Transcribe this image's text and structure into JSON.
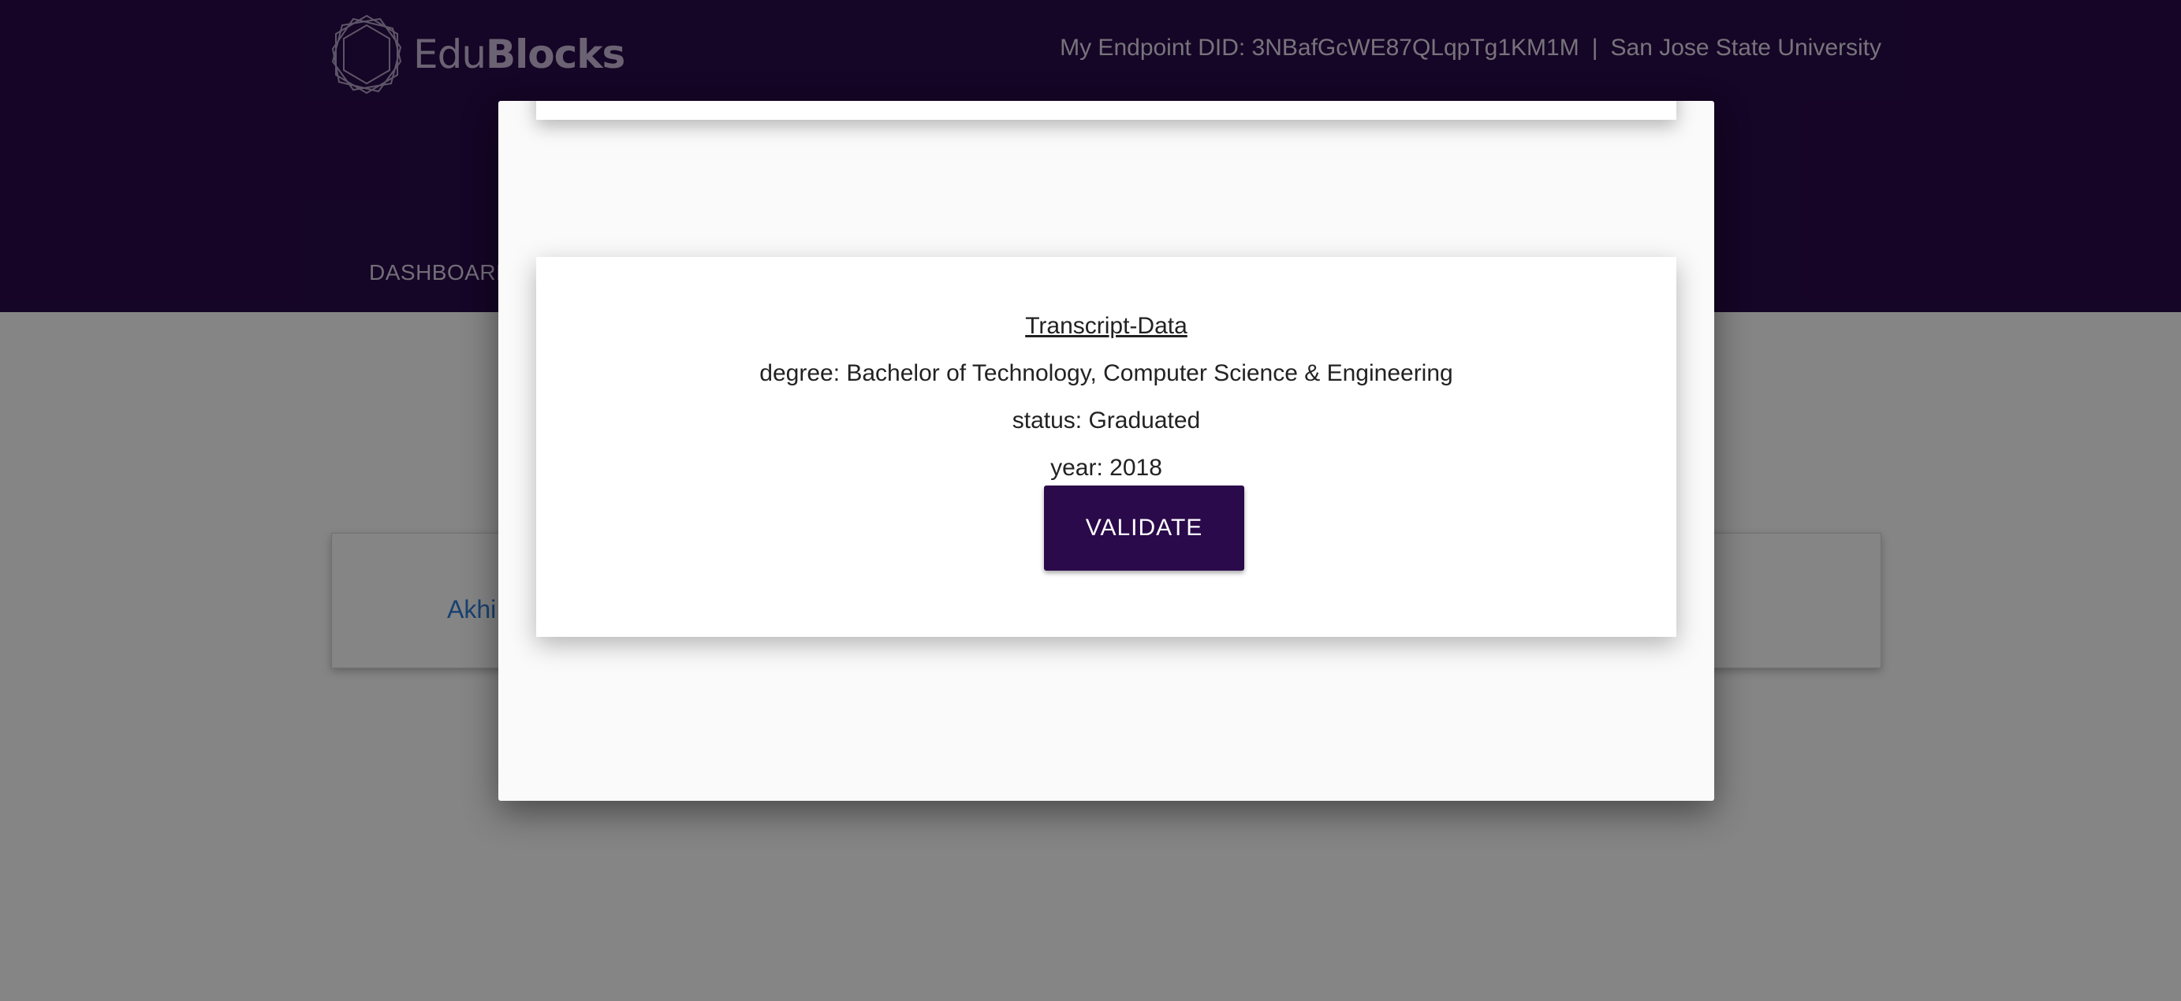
{
  "colors": {
    "header_bg": "#2a0a4a",
    "accent": "#2a0a4a",
    "link": "#2f7ed8",
    "modal_bg": "#fafafa"
  },
  "header": {
    "logo": {
      "text_light": "Edu",
      "text_bold": "Blocks",
      "icon": "hexagon-logo-icon"
    },
    "endpoint_label": "My Endpoint DID: 3NBafGcWE87QLqpTg1KM1M",
    "separator": "|",
    "institution": "San Jose State University",
    "nav": {
      "dashboard": "DASHBOARD"
    }
  },
  "background": {
    "student_name_partial": "Akhi"
  },
  "modal": {
    "card": {
      "title": "Transcript-Data",
      "degree": "degree: Bachelor of Technology, Computer Science & Engineering",
      "status": "status: Graduated",
      "year": "year: 2018",
      "validate_label": "VALIDATE"
    }
  }
}
